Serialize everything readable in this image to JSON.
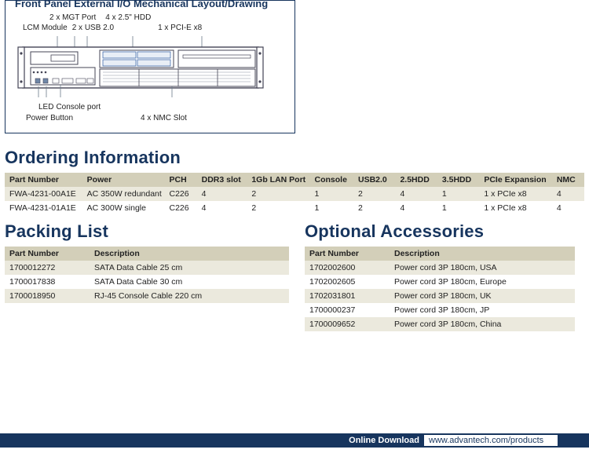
{
  "drawing": {
    "title": "Front Panel External I/O Mechanical Layout/Drawing",
    "top_labels": {
      "mgt": "2 x MGT Port",
      "hdd25": "4 x 2.5\" HDD",
      "lcm": "LCM Module",
      "usb": "2 x USB 2.0",
      "pcie": "1 x PCI-E x8"
    },
    "bottom_labels": {
      "led": "LED",
      "console": "Console port",
      "power": "Power Button",
      "nmc": "4 x NMC Slot"
    }
  },
  "ordering": {
    "heading": "Ordering Information",
    "headers": [
      "Part Number",
      "Power",
      "PCH",
      "DDR3 slot",
      "1Gb LAN Port",
      "Console",
      "USB2.0",
      "2.5HDD",
      "3.5HDD",
      "PCIe Expansion",
      "NMC"
    ],
    "rows": [
      [
        "FWA-4231-00A1E",
        "AC 350W redundant",
        "C226",
        "4",
        "2",
        "1",
        "2",
        "4",
        "1",
        "1 x PCIe x8",
        "4"
      ],
      [
        "FWA-4231-01A1E",
        "AC 300W single",
        "C226",
        "4",
        "2",
        "1",
        "2",
        "4",
        "1",
        "1 x PCIe x8",
        "4"
      ]
    ]
  },
  "packing": {
    "heading": "Packing List",
    "headers": [
      "Part Number",
      "Description"
    ],
    "rows": [
      [
        "1700012272",
        "SATA Data Cable 25 cm"
      ],
      [
        "1700017838",
        "SATA Data Cable 30 cm"
      ],
      [
        "1700018950",
        "RJ-45 Console Cable 220 cm"
      ]
    ]
  },
  "accessories": {
    "heading": "Optional Accessories",
    "headers": [
      "Part Number",
      "Description"
    ],
    "rows": [
      [
        "1702002600",
        "Power cord 3P 180cm, USA"
      ],
      [
        "1702002605",
        "Power cord 3P 180cm, Europe"
      ],
      [
        "1702031801",
        "Power cord 3P 180cm, UK"
      ],
      [
        "1700000237",
        "Power cord 3P 180cm, JP"
      ],
      [
        "1700009652",
        "Power cord 3P 180cm, China"
      ]
    ]
  },
  "footer": {
    "label": "Online Download",
    "url": "www.advantech.com/products"
  }
}
